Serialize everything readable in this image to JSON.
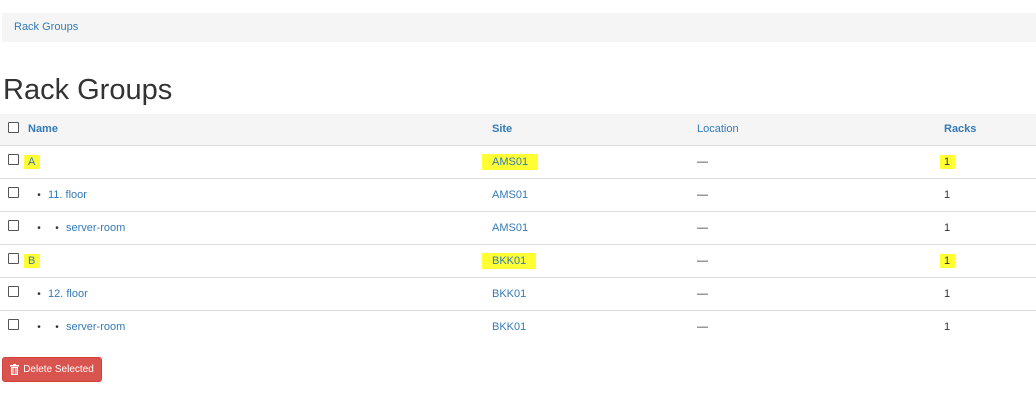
{
  "breadcrumb": {
    "items": [
      "Rack Groups"
    ]
  },
  "page": {
    "title": "Rack Groups"
  },
  "table": {
    "columns": [
      "Name",
      "Site",
      "Location",
      "Racks"
    ],
    "rows": [
      {
        "name": "A",
        "depth": 0,
        "site": "AMS01",
        "location": "—",
        "racks": "1",
        "highlighted": true
      },
      {
        "name": "11. floor",
        "depth": 1,
        "site": "AMS01",
        "location": "—",
        "racks": "1",
        "highlighted": false
      },
      {
        "name": "server-room",
        "depth": 2,
        "site": "AMS01",
        "location": "—",
        "racks": "1",
        "highlighted": false
      },
      {
        "name": "B",
        "depth": 0,
        "site": "BKK01",
        "location": "—",
        "racks": "1",
        "highlighted": true
      },
      {
        "name": "12. floor",
        "depth": 1,
        "site": "BKK01",
        "location": "—",
        "racks": "1",
        "highlighted": false
      },
      {
        "name": "server-room",
        "depth": 2,
        "site": "BKK01",
        "location": "—",
        "racks": "1",
        "highlighted": false
      }
    ]
  },
  "actions": {
    "delete_label": "Delete Selected",
    "delete_icon": "trash-icon"
  },
  "colors": {
    "link": "#337ab7",
    "highlight": "#ffff33",
    "danger": "#d9534f"
  }
}
